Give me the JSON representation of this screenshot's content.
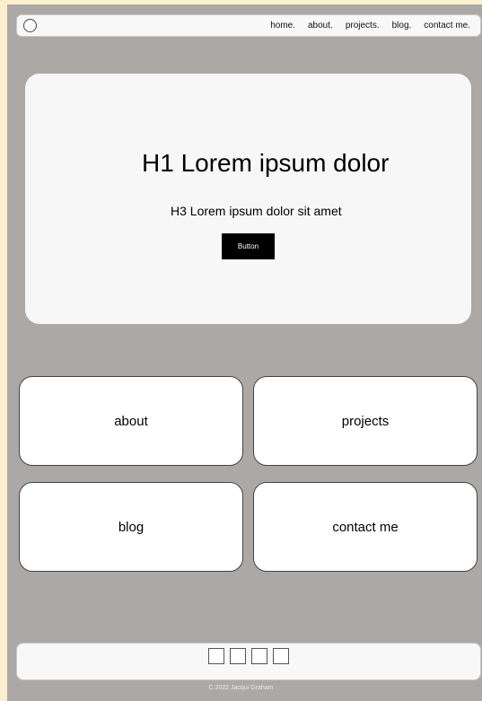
{
  "nav": {
    "links": [
      "home.",
      "about.",
      "projects.",
      "blog.",
      "contact me."
    ]
  },
  "hero": {
    "title": "H1 Lorem ipsum dolor",
    "subtitle": "H3 Lorem ipsum dolor sit amet",
    "button_label": "Button"
  },
  "cards": [
    "about",
    "projects",
    "blog",
    "contact me"
  ],
  "footer": {
    "social_icons": [
      "social-icon",
      "social-icon",
      "social-icon",
      "social-icon"
    ],
    "copyright": "C 2022 Jacqui Graham"
  },
  "colors": {
    "page_background": "#fcf0cc",
    "frame_background": "#aca8a6",
    "surface": "#f7f7f8",
    "button_background": "#000000"
  }
}
